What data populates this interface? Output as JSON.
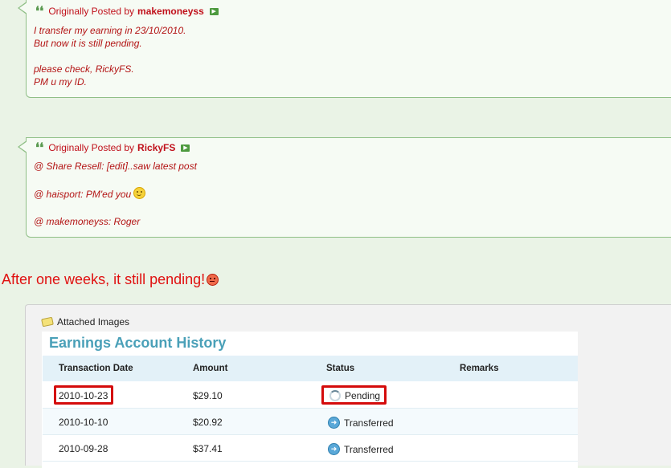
{
  "quotes": [
    {
      "prefix": "Originally Posted by",
      "author": "makemoneyss",
      "lines": [
        "I transfer my earning in 23/10/2010.",
        "But now it is still pending.",
        "",
        "please check, RickyFS.",
        "PM u my ID."
      ]
    },
    {
      "prefix": "Originally Posted by",
      "author": "RickyFS",
      "lines": [
        "@ Share Resell: [edit]..saw latest post",
        "",
        "@ haisport: PM'ed you",
        "",
        "@ makemoneyss: Roger"
      ]
    }
  ],
  "post_text": "After one weeks, it still pending!",
  "attachments": {
    "title": "Attached Images",
    "screenshot": {
      "title": "Earnings Account History",
      "columns": [
        "Transaction Date",
        "Amount",
        "Status",
        "Remarks"
      ],
      "rows": [
        {
          "date": "2010-10-23",
          "amount": "$29.10",
          "status": "Pending",
          "remarks": ""
        },
        {
          "date": "2010-10-10",
          "amount": "$20.92",
          "status": "Transferred",
          "remarks": ""
        },
        {
          "date": "2010-09-28",
          "amount": "$37.41",
          "status": "Transferred",
          "remarks": ""
        }
      ]
    }
  },
  "colors": {
    "quote_text": "#b31414",
    "headline": "#e01010",
    "highlight": "#d40b0b",
    "table_title": "#4aa0b8"
  },
  "icons": {
    "quote": "quote-icon",
    "view_post": "view-post-icon",
    "smiley": "smiley-icon",
    "angry": "angry-face-icon",
    "attachment": "attachment-icon",
    "pending": "loading-spinner-icon",
    "transferred": "arrow-circle-icon"
  }
}
